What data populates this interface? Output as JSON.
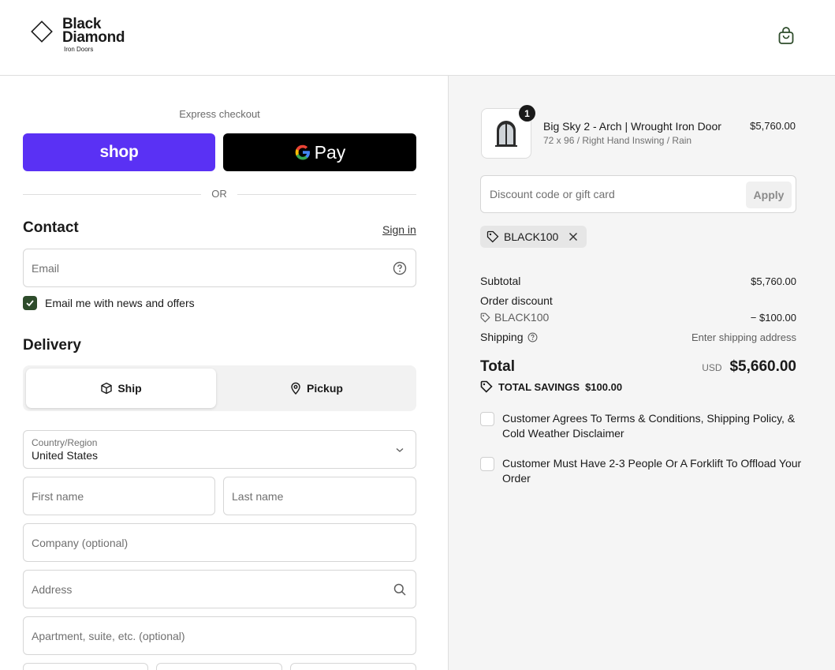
{
  "brand": {
    "name_line1": "Black",
    "name_line2": "Diamond",
    "tagline": "Iron Doors"
  },
  "express": {
    "label": "Express checkout",
    "shop_label": "shop",
    "gpay_label": "Pay",
    "or_label": "OR"
  },
  "contact": {
    "title": "Contact",
    "sign_in": "Sign in",
    "email_placeholder": "Email",
    "newsletter_label": "Email me with news and offers",
    "newsletter_checked": true
  },
  "delivery": {
    "title": "Delivery",
    "ship_label": "Ship",
    "pickup_label": "Pickup",
    "country_label": "Country/Region",
    "country_value": "United States",
    "first_name_placeholder": "First name",
    "last_name_placeholder": "Last name",
    "company_placeholder": "Company (optional)",
    "address_placeholder": "Address",
    "apartment_placeholder": "Apartment, suite, etc. (optional)"
  },
  "order": {
    "item": {
      "quantity": "1",
      "title": "Big Sky 2 - Arch | Wrought Iron Door",
      "variant": "72 x 96 / Right Hand Inswing / Rain",
      "price": "$5,760.00"
    },
    "discount_placeholder": "Discount code or gift card",
    "apply_label": "Apply",
    "applied_code": "BLACK100",
    "subtotal_label": "Subtotal",
    "subtotal_value": "$5,760.00",
    "order_discount_label": "Order discount",
    "discount_code": "BLACK100",
    "discount_value": "− $100.00",
    "shipping_label": "Shipping",
    "shipping_value": "Enter shipping address",
    "total_label": "Total",
    "total_currency": "USD",
    "total_value": "$5,660.00",
    "savings_label": "TOTAL SAVINGS",
    "savings_value": "$100.00",
    "agreement_1": "Customer Agrees To Terms & Conditions, Shipping Policy, & Cold Weather Disclaimer",
    "agreement_2": "Customer Must Have 2-3 People Or A Forklift To Offload Your Order"
  },
  "colors": {
    "shop_purple": "#5a31f4",
    "checkbox_green": "#2e4c2b"
  }
}
